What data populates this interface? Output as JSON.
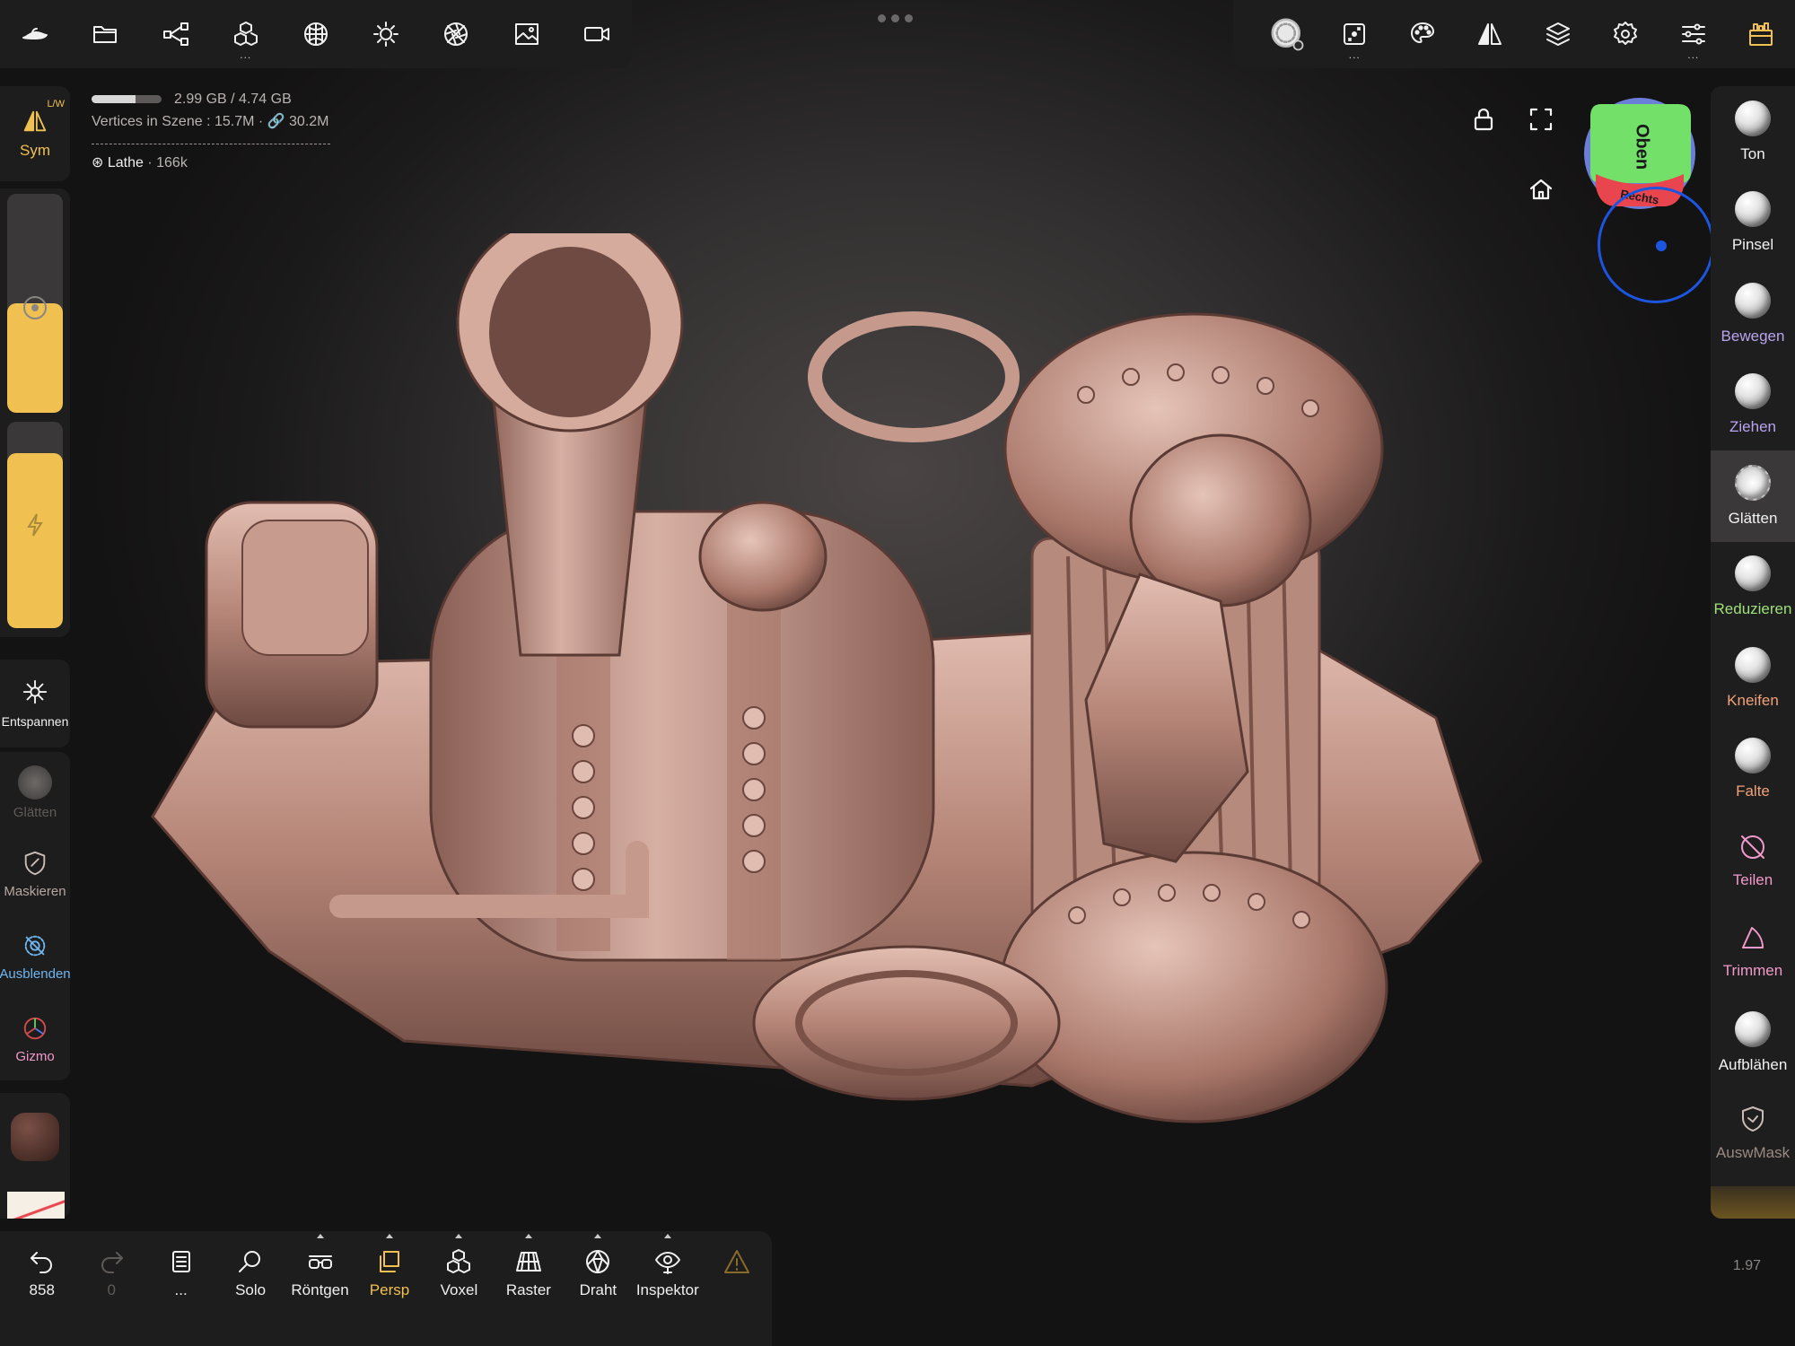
{
  "colors": {
    "accent": "#f0c050",
    "selection": "#3a3838",
    "panel": "#1e1d1d",
    "purple": "#b9a4f0",
    "green": "#9ee07a",
    "orange": "#f0a27a",
    "blue": "#6fb7f0",
    "pink": "#f09acb",
    "brown": "#9a8a80"
  },
  "top_left_tools": [
    {
      "icon": "nomad-logo-icon"
    },
    {
      "icon": "folder-icon"
    },
    {
      "icon": "scene-tree-icon"
    },
    {
      "icon": "mesh-icon",
      "more": "..."
    },
    {
      "icon": "topology-icon"
    },
    {
      "icon": "light-icon"
    },
    {
      "icon": "material-icon"
    },
    {
      "icon": "background-image-icon"
    },
    {
      "icon": "camera-icon"
    }
  ],
  "top_right_tools": [
    {
      "icon": "brush-stroke-icon"
    },
    {
      "icon": "stroke-settings-icon",
      "more": "..."
    },
    {
      "icon": "palette-icon"
    },
    {
      "icon": "symmetry-icon"
    },
    {
      "icon": "layers-icon"
    },
    {
      "icon": "settings-gear-icon"
    },
    {
      "icon": "sliders-icon",
      "more": "..."
    },
    {
      "icon": "toolbox-icon"
    }
  ],
  "info": {
    "memory": "2.99 GB / 4.74 GB",
    "memory_fraction": 0.63,
    "vertices_label": "Vertices in Szene :",
    "vertices": "15.7M",
    "linked": "30.2M",
    "object_name": "Lathe",
    "object_count": "166k"
  },
  "gizmo": {
    "top": "Oben",
    "right": "Rechts"
  },
  "left_sidebar": {
    "sym_label": "Sym",
    "sym_badge": "L/W",
    "radius_fraction": 0.5,
    "intensity_fraction": 0.85,
    "tools": [
      {
        "label": "Entspannen"
      },
      {
        "label": "Glätten"
      },
      {
        "label": "Maskieren"
      },
      {
        "label": "Ausblenden"
      },
      {
        "label": "Gizmo"
      }
    ]
  },
  "right_tools": [
    {
      "label": "Ton"
    },
    {
      "label": "Pinsel"
    },
    {
      "label": "Bewegen"
    },
    {
      "label": "Ziehen"
    },
    {
      "label": "Glätten"
    },
    {
      "label": "Reduzieren"
    },
    {
      "label": "Kneifen"
    },
    {
      "label": "Falte"
    },
    {
      "label": "Teilen"
    },
    {
      "label": "Trimmen"
    },
    {
      "label": "Aufblähen"
    },
    {
      "label": "AuswMask"
    }
  ],
  "bottom": {
    "undo_count": "858",
    "redo_count": "0",
    "more": "...",
    "labels": [
      "Solo",
      "Röntgen",
      "Persp",
      "Voxel",
      "Raster",
      "Draht",
      "Inspektor"
    ],
    "version": "1.97"
  }
}
